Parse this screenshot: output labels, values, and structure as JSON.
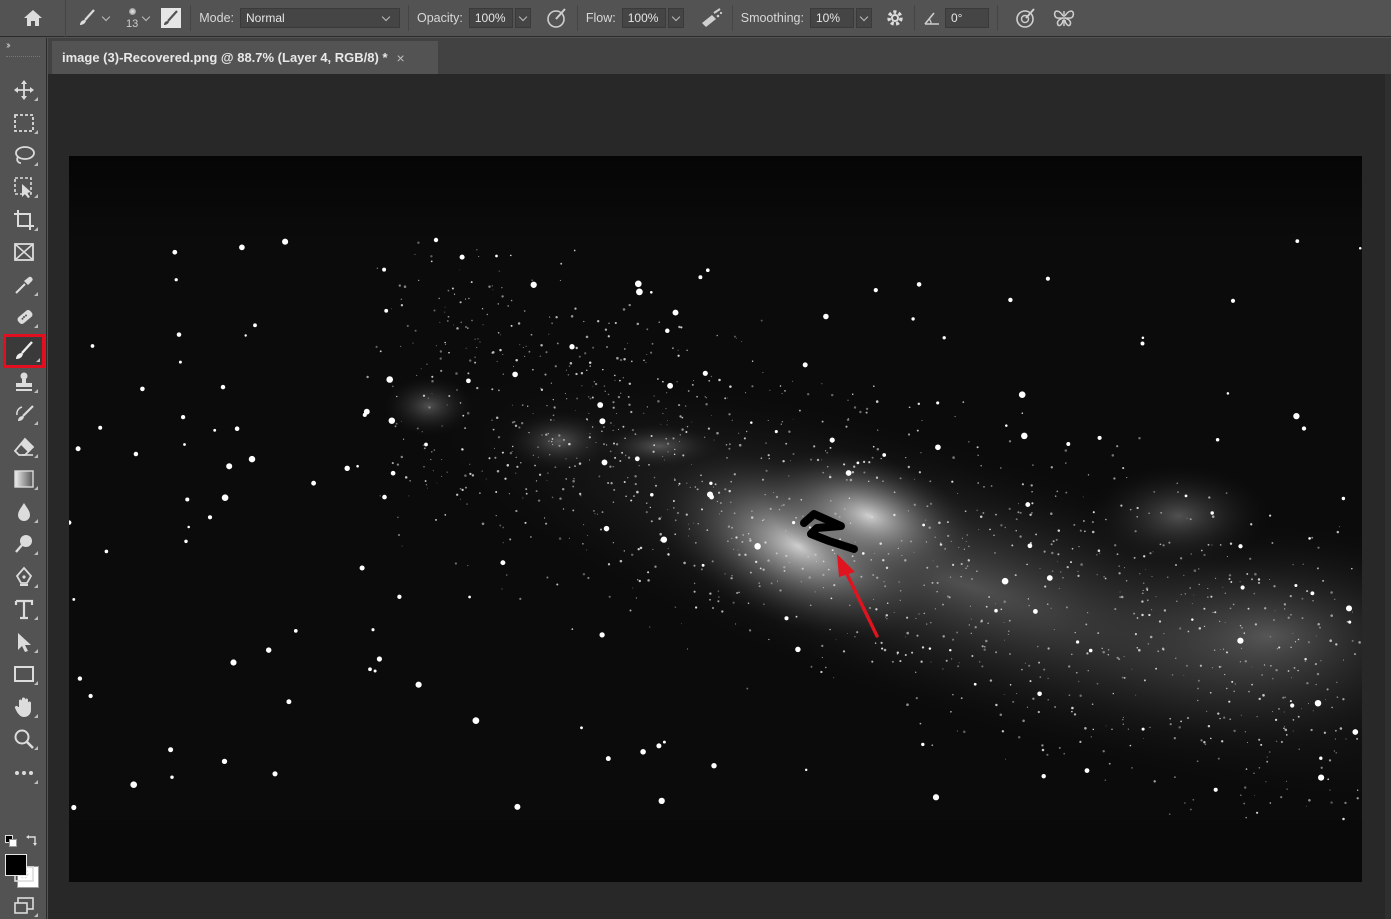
{
  "options_bar": {
    "brush_size": "13",
    "mode_label": "Mode:",
    "mode_value": "Normal",
    "opacity_label": "Opacity:",
    "opacity_value": "100%",
    "flow_label": "Flow:",
    "flow_value": "100%",
    "smoothing_label": "Smoothing:",
    "smoothing_value": "10%",
    "angle_value": "0°"
  },
  "document_tab": {
    "title": "image (3)-Recovered.png @ 88.7% (Layer 4, RGB/8) *",
    "close": "×"
  },
  "toolbar": {
    "collapse_glyph": "››",
    "tools": [
      {
        "name": "move-tool",
        "icon": "move-icon"
      },
      {
        "name": "rectangular-marquee-tool",
        "icon": "marquee-icon"
      },
      {
        "name": "lasso-tool",
        "icon": "lasso-icon"
      },
      {
        "name": "object-selection-tool",
        "icon": "object-selection-icon"
      },
      {
        "name": "crop-tool",
        "icon": "crop-icon"
      },
      {
        "name": "frame-tool",
        "icon": "frame-icon"
      },
      {
        "name": "eyedropper-tool",
        "icon": "eyedropper-icon"
      },
      {
        "name": "healing-brush-tool",
        "icon": "bandage-icon"
      },
      {
        "name": "brush-tool",
        "icon": "brush-icon",
        "active": true
      },
      {
        "name": "clone-stamp-tool",
        "icon": "stamp-icon"
      },
      {
        "name": "history-brush-tool",
        "icon": "history-brush-icon"
      },
      {
        "name": "eraser-tool",
        "icon": "eraser-icon"
      },
      {
        "name": "gradient-tool",
        "icon": "gradient-icon"
      },
      {
        "name": "blur-tool",
        "icon": "droplet-icon"
      },
      {
        "name": "dodge-tool",
        "icon": "dodge-icon"
      },
      {
        "name": "pen-tool",
        "icon": "pen-icon"
      },
      {
        "name": "type-tool",
        "icon": "type-icon"
      },
      {
        "name": "path-selection-tool",
        "icon": "arrow-icon"
      },
      {
        "name": "rectangle-tool",
        "icon": "rectangle-icon"
      },
      {
        "name": "hand-tool",
        "icon": "hand-icon"
      },
      {
        "name": "zoom-tool",
        "icon": "zoom-icon"
      },
      {
        "name": "edit-toolbar",
        "icon": "more-icon"
      }
    ],
    "foreground_color": "#000000",
    "background_color": "#ffffff"
  },
  "colors": {
    "highlight": "#e10f1f",
    "arrow": "#e0141e",
    "ui_panel": "#535353",
    "workspace": "#282828"
  }
}
